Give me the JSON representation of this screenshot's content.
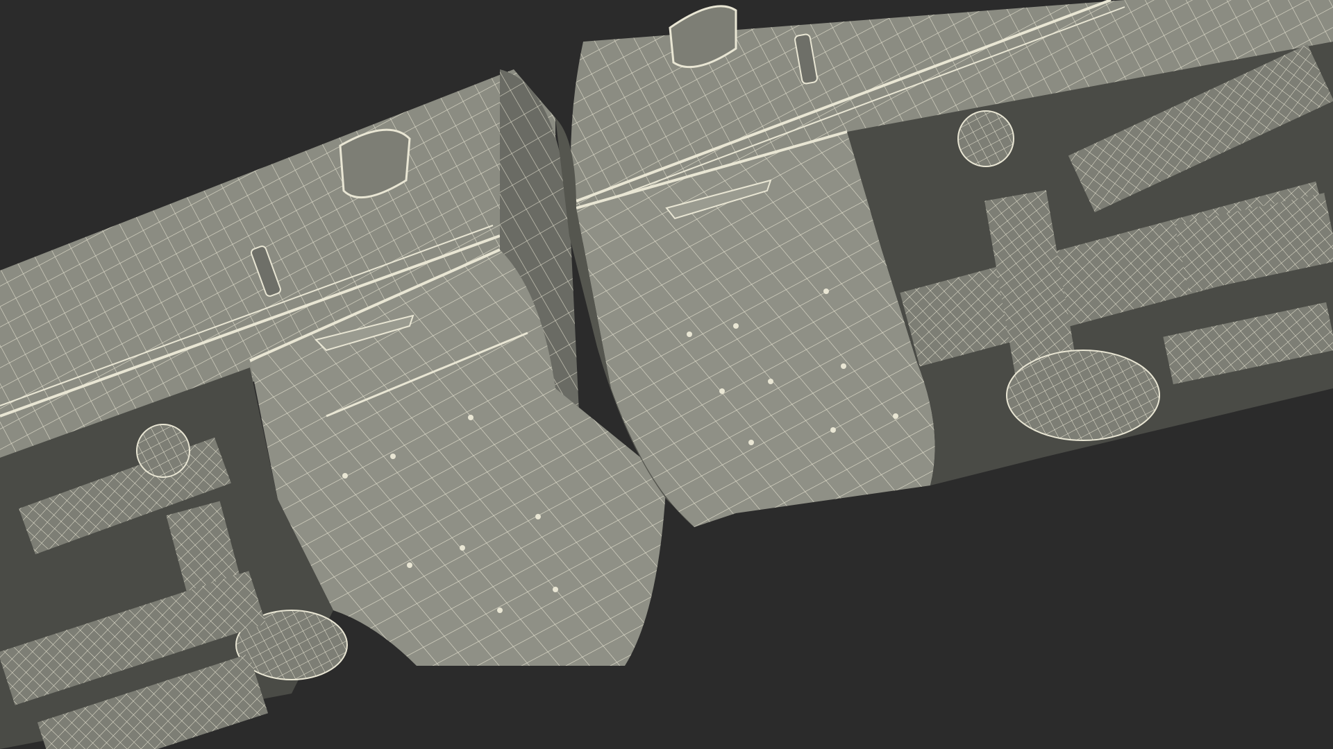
{
  "scene": {
    "background_color": "#2b2b2b",
    "wire_color": "#e9e6d4",
    "surface_color": "#8b8c82",
    "shadow_color": "#5f605a",
    "dark_cavity_color": "#4a4b46",
    "subject": "wireframe-train-cars-coupled"
  }
}
